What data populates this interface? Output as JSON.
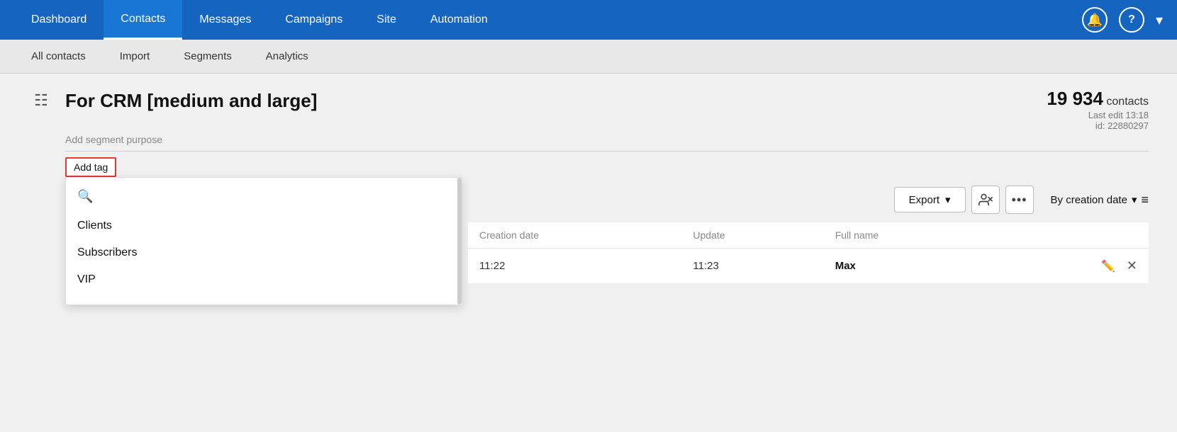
{
  "nav": {
    "items": [
      {
        "label": "Dashboard",
        "active": false
      },
      {
        "label": "Contacts",
        "active": true
      },
      {
        "label": "Messages",
        "active": false
      },
      {
        "label": "Campaigns",
        "active": false
      },
      {
        "label": "Site",
        "active": false
      },
      {
        "label": "Automation",
        "active": false
      }
    ],
    "icons": {
      "bell": "🔔",
      "help": "?",
      "chevron": "▾"
    }
  },
  "subnav": {
    "items": [
      {
        "label": "All contacts"
      },
      {
        "label": "Import"
      },
      {
        "label": "Segments"
      },
      {
        "label": "Analytics"
      }
    ]
  },
  "segment": {
    "title": "For CRM [medium and large]",
    "add_purpose": "Add segment purpose",
    "add_tag": "Add tag",
    "contact_count": "19 934",
    "contacts_label": "contacts",
    "last_edit": "Last edit 13:18",
    "id_label": "id: 22880297"
  },
  "tag_dropdown": {
    "search_placeholder": "",
    "items": [
      {
        "label": "Clients"
      },
      {
        "label": "Subscribers"
      },
      {
        "label": "VIP"
      }
    ]
  },
  "toolbar": {
    "export_label": "Export",
    "sort_label": "By creation date"
  },
  "table": {
    "columns": [
      {
        "label": "Creation date"
      },
      {
        "label": "Update"
      },
      {
        "label": "Full name"
      }
    ],
    "rows": [
      {
        "creation_date": "11:22",
        "update": "11:23",
        "full_name": "Max"
      }
    ]
  }
}
